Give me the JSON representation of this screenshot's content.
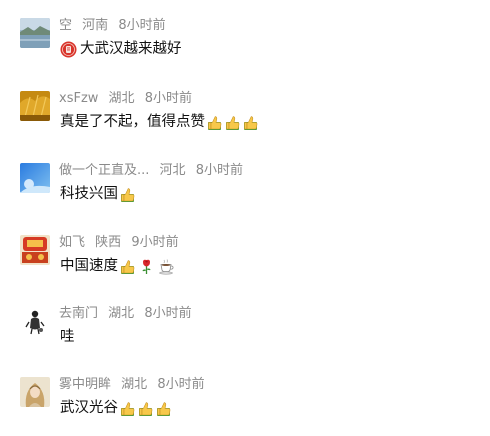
{
  "comments": [
    {
      "avatar_icon": "lake-landscape-avatar-icon",
      "username": "空",
      "location": "河南",
      "time": "8小时前",
      "lead_icon": "red-badge-icon",
      "text": "大武汉越来越好",
      "trailing_icons": []
    },
    {
      "avatar_icon": "golden-field-avatar-icon",
      "username": "xsFzw",
      "location": "湖北",
      "time": "8小时前",
      "text": "真是了不起，值得点赞",
      "trailing_icons": [
        "thumbs-up-icon",
        "thumbs-up-icon",
        "thumbs-up-icon"
      ]
    },
    {
      "avatar_icon": "blue-sky-avatar-icon",
      "username": "做一个正直及...",
      "location": "河北",
      "time": "8小时前",
      "text": "科技兴国",
      "trailing_icons": [
        "thumbs-up-icon"
      ]
    },
    {
      "avatar_icon": "festive-red-avatar-icon",
      "username": "如飞",
      "location": "陕西",
      "time": "9小时前",
      "text": "中国速度",
      "trailing_icons": [
        "thumbs-up-icon",
        "rose-icon",
        "coffee-icon"
      ]
    },
    {
      "avatar_icon": "ink-figure-avatar-icon",
      "username": "去南门",
      "location": "湖北",
      "time": "8小时前",
      "text": "哇",
      "trailing_icons": []
    },
    {
      "avatar_icon": "portrait-avatar-icon",
      "username": "雾中明眸",
      "location": "湖北",
      "time": "8小时前",
      "text": "武汉光谷",
      "trailing_icons": [
        "thumbs-up-icon",
        "thumbs-up-icon",
        "thumbs-up-icon"
      ]
    }
  ]
}
